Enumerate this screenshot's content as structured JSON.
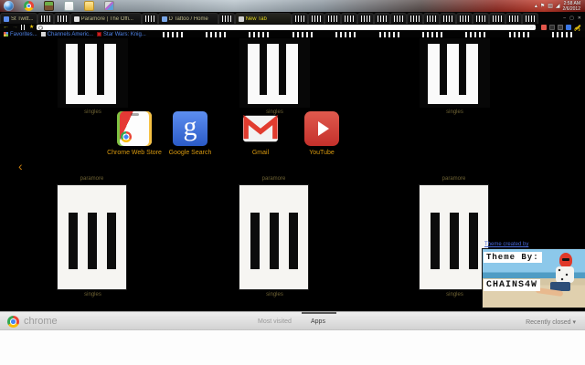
{
  "taskbar": {
    "time": "2:58 AM",
    "date": "2/6/2012"
  },
  "tab_strip": {
    "tabs": [
      {
        "label": "St Twitt..."
      },
      {
        "label": "Paramore | The Offi..."
      },
      {
        "label": "D Tattoo / Home"
      },
      {
        "label": "New Tab"
      }
    ],
    "trailing_icon_tab_count": 15
  },
  "toolbar": {
    "url_value": ""
  },
  "bookmarks": {
    "items": [
      {
        "label": "Favorites..."
      },
      {
        "label": "Channels Americ..."
      },
      {
        "label": "Star Wars: Knig..."
      }
    ],
    "icon_item_count": 10
  },
  "most_visited": {
    "top_tiles": [
      {
        "caption": "singles"
      },
      {
        "caption": "singles"
      },
      {
        "caption": "singles"
      }
    ],
    "bottom_tiles": [
      {
        "title": "paramore",
        "caption": "singles"
      },
      {
        "title": "paramore",
        "caption": "singles"
      },
      {
        "title": "paramore",
        "caption": "singles"
      }
    ]
  },
  "apps": {
    "items": [
      {
        "label": "Chrome Web Store"
      },
      {
        "label": "Google Search"
      },
      {
        "label": "Gmail"
      },
      {
        "label": "YouTube"
      }
    ]
  },
  "carousel": {
    "prev": "‹"
  },
  "footer": {
    "brand": "chrome",
    "most_visited_label": "Most visited",
    "apps_label": "Apps",
    "recently_closed_label": "Recently closed",
    "recently_closed_arrow": "▾"
  },
  "theme_badge": {
    "link_label": "Theme created by",
    "line1": "Theme By:",
    "line2": "CHAINS4W"
  },
  "colors": {
    "accent_orange": "#d7980f",
    "dim_caption": "#6e6233",
    "bookmark_blue": "#4f83e8",
    "active_tab_yellow": "#ded41f",
    "page_bg": "#000000"
  }
}
